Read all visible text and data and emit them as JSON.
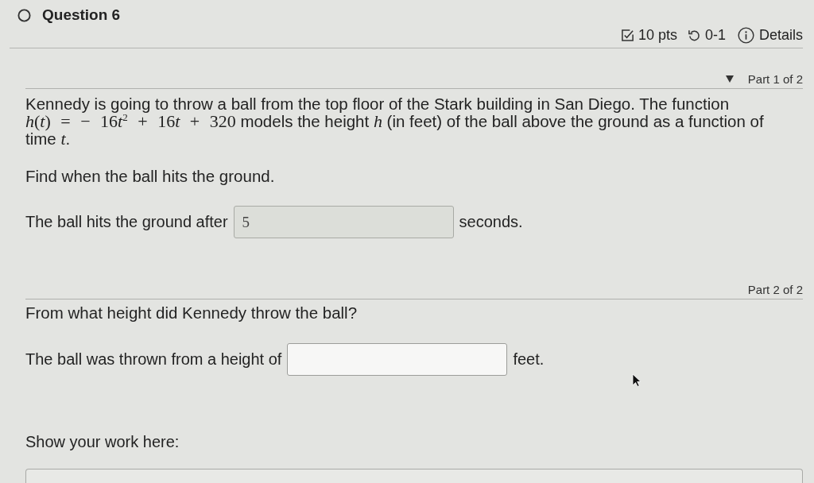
{
  "question": {
    "title": "Question 6",
    "points": "10 pts",
    "attempts": "0-1",
    "details": "Details"
  },
  "parts": [
    {
      "label": "Part 1 of 2",
      "expanded": true,
      "paragraphs": [
        [
          {
            "kind": "text",
            "text": "Kennedy is going to throw a ball from the top floor of the Stark building in San Diego. The function "
          },
          {
            "kind": "math",
            "text": "*h*(*t*) = − 16"
          },
          {
            "kind": "math",
            "text": "*t*"
          },
          {
            "kind": "math",
            "text": "$^{2}$ + 16"
          },
          {
            "kind": "math",
            "text": "*t*"
          },
          {
            "kind": "math",
            "text": " + 320"
          },
          {
            "kind": "text",
            "text": " models the height "
          },
          {
            "kind": "math",
            "text": "*h*"
          },
          {
            "kind": "text",
            "text": " (in feet) of the ball above the ground as a function of time "
          },
          {
            "kind": "math",
            "text": "*t*"
          },
          {
            "kind": "text",
            "text": "."
          }
        ],
        [
          {
            "kind": "text",
            "text": "Find when the ball hits the ground."
          }
        ]
      ],
      "answer": {
        "before": "The ball hits the ground after",
        "value": "5",
        "after": "seconds.",
        "disabled": true
      }
    },
    {
      "label": "Part 2 of 2",
      "paragraphs": [
        [
          {
            "kind": "text",
            "text": "From what height did Kennedy throw the ball?"
          }
        ]
      ],
      "answer": {
        "before": "The ball was thrown from a height of",
        "after": "feet.",
        "disabled": false
      }
    }
  ],
  "work": {
    "label": "Show your work here:"
  }
}
